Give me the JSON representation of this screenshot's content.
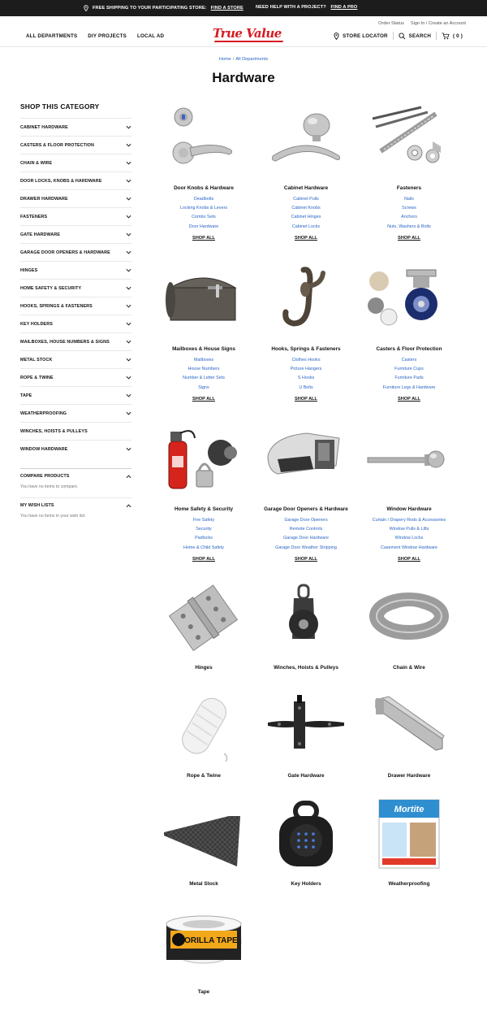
{
  "promo": {
    "shipping": "FREE SHIPPING TO YOUR PARTICIPATING STORE:",
    "find_store": "FIND A STORE",
    "help": "NEED HELP WITH A PROJECT?",
    "find_pro": "FIND A PRO"
  },
  "header": {
    "order_status": "Order Status",
    "sign_in": "Sign In / Create an Account",
    "nav": [
      "ALL DEPARTMENTS",
      "DIY PROJECTS",
      "LOCAL AD"
    ],
    "logo": "True Value",
    "store_locator": "STORE LOCATOR",
    "search": "SEARCH",
    "cart_count": "( 0 )",
    "brand_color": "#d71920"
  },
  "breadcrumb": {
    "home": "Home",
    "all_departments": "All Departments"
  },
  "page_title": "Hardware",
  "sidebar": {
    "heading": "SHOP THIS CATEGORY",
    "categories": [
      "CABINET HARDWARE",
      "CASTERS & FLOOR PROTECTION",
      "CHAIN & WIRE",
      "DOOR LOCKS, KNOBS & HARDWARE",
      "DRAWER HARDWARE",
      "FASTENERS",
      "GATE HARDWARE",
      "GARAGE DOOR OPENERS & HARDWARE",
      "HINGES",
      "HOME SAFETY & SECURITY",
      "HOOKS, SPRINGS & FASTENERS",
      "KEY HOLDERS",
      "MAILBOXES, HOUSE NUMBERS & SIGNS",
      "METAL STOCK",
      "ROPE & TWINE",
      "TAPE",
      "WEATHERPROOFING",
      "WINCHES, HOISTS & PULLEYS",
      "WINDOW HARDWARE"
    ],
    "compare_heading": "COMPARE PRODUCTS",
    "compare_text": "You have no items to compare.",
    "wish_heading": "MY WISH LISTS",
    "wish_text": "You have no items in your wish list."
  },
  "shop_all_label": "SHOP ALL",
  "categories": [
    {
      "name": "Door Knobs & Hardware",
      "icon": "door-knob-image",
      "links": [
        "Deadbolts",
        "Locking Knobs & Levers",
        "Combo Sets",
        "Door Hardware"
      ]
    },
    {
      "name": "Cabinet Hardware",
      "icon": "cabinet-pull-image",
      "links": [
        "Cabinet Pulls",
        "Cabinet Knobs",
        "Cabinet Hinges",
        "Cabinet Locks"
      ]
    },
    {
      "name": "Fasteners",
      "icon": "screws-nuts-image",
      "links": [
        "Nails",
        "Screws",
        "Anchors",
        "Nuts, Washers & Bolts"
      ]
    },
    {
      "name": "Mailboxes & House Signs",
      "icon": "mailbox-image",
      "links": [
        "Mailboxes",
        "House Numbers",
        "Number & Letter Sets",
        "Signs"
      ]
    },
    {
      "name": "Hooks, Springs & Fasteners",
      "icon": "hook-image",
      "links": [
        "Clothes Hooks",
        "Picture Hangers",
        "S Hooks",
        "U Bolts"
      ]
    },
    {
      "name": "Casters & Floor Protection",
      "icon": "caster-image",
      "links": [
        "Casters",
        "Furniture Cups",
        "Furniture Pads",
        "Furniture Legs & Hardware"
      ]
    },
    {
      "name": "Home Safety & Security",
      "icon": "extinguisher-image",
      "links": [
        "Fire Safety",
        "Security",
        "Padlocks",
        "Home & Child Safety"
      ]
    },
    {
      "name": "Garage Door Openers & Hardware",
      "icon": "garage-opener-image",
      "links": [
        "Garage Door Openers",
        "Remote Controls",
        "Garage Door Hardware",
        "Garage Door Weather Stripping"
      ]
    },
    {
      "name": "Window Hardware",
      "icon": "curtain-rod-image",
      "links": [
        "Curtain / Drapery Rods & Accessories",
        "Window Pulls & Lifts",
        "Window Locks",
        "Casement Window Hardware"
      ]
    },
    {
      "name": "Hinges",
      "icon": "hinge-image",
      "links": []
    },
    {
      "name": "Winches, Hoists & Pulleys",
      "icon": "pulley-image",
      "links": []
    },
    {
      "name": "Chain & Wire",
      "icon": "wire-coil-image",
      "links": []
    },
    {
      "name": "Rope & Twine",
      "icon": "rope-image",
      "links": []
    },
    {
      "name": "Gate Hardware",
      "icon": "gate-hinge-image",
      "links": []
    },
    {
      "name": "Drawer Hardware",
      "icon": "drawer-slide-image",
      "links": []
    },
    {
      "name": "Metal Stock",
      "icon": "metal-sheet-image",
      "links": []
    },
    {
      "name": "Key Holders",
      "icon": "key-lockbox-image",
      "links": []
    },
    {
      "name": "Weatherproofing",
      "icon": "mortite-box-image",
      "links": []
    },
    {
      "name": "Tape",
      "icon": "gorilla-tape-image",
      "links": []
    }
  ],
  "product_text": {
    "mortite": "Mortite",
    "gorilla_tape": "GORILLA TAPE"
  }
}
